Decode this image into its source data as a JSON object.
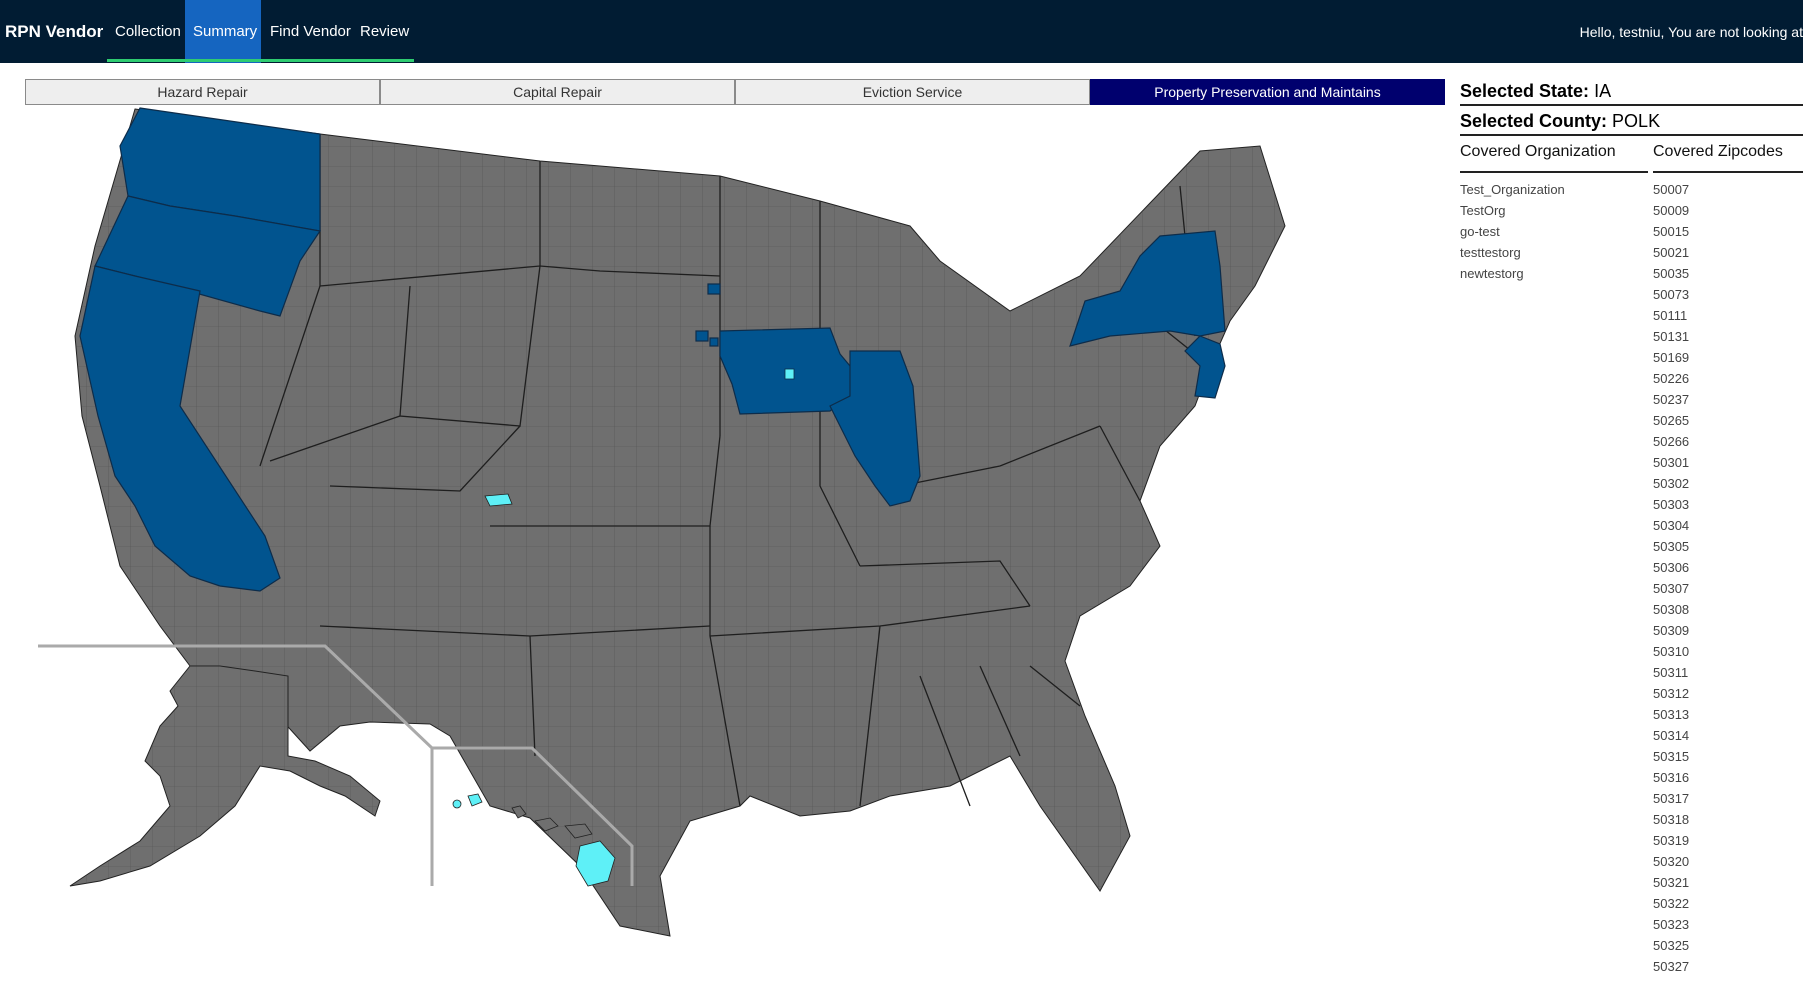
{
  "nav": {
    "brand": "RPN Vendor",
    "items": [
      {
        "label": "Collection"
      },
      {
        "label": "Summary"
      },
      {
        "label": "Find Vendor"
      },
      {
        "label": "Review"
      }
    ],
    "greeting": "Hello, testniu, You are not looking at"
  },
  "tabs": [
    {
      "label": "Hazard Repair"
    },
    {
      "label": "Capital Repair"
    },
    {
      "label": "Eviction Service"
    },
    {
      "label": "Property Preservation and Maintains"
    }
  ],
  "colors": {
    "nav_bg": "#011c33",
    "active_nav": "#1565c0",
    "active_tab": "#00006e",
    "state_default": "#6f6f6f",
    "state_covered": "#01548f",
    "county_selected": "#5ef0f7"
  },
  "side": {
    "state_label": "Selected State:",
    "state_value": "IA",
    "county_label": "Selected County:",
    "county_value": "POLK",
    "org_header": "Covered Organization",
    "zip_header": "Covered Zipcodes",
    "organizations": [
      "Test_Organization",
      "TestOrg",
      "go-test",
      "testtestorg",
      "newtestorg"
    ],
    "zipcodes": [
      "50007",
      "50009",
      "50015",
      "50021",
      "50035",
      "50073",
      "50111",
      "50131",
      "50169",
      "50226",
      "50237",
      "50265",
      "50266",
      "50301",
      "50302",
      "50303",
      "50304",
      "50305",
      "50306",
      "50307",
      "50308",
      "50309",
      "50310",
      "50311",
      "50312",
      "50313",
      "50314",
      "50315",
      "50316",
      "50317",
      "50318",
      "50319",
      "50320",
      "50321",
      "50322",
      "50323",
      "50325",
      "50327"
    ]
  },
  "map": {
    "covered_states": [
      "Washington",
      "Oregon",
      "California",
      "Iowa",
      "Illinois",
      "New York",
      "New Jersey"
    ],
    "highlighted_regions": [
      "Polk County, IA",
      "Colorado county",
      "Hawaii"
    ]
  }
}
